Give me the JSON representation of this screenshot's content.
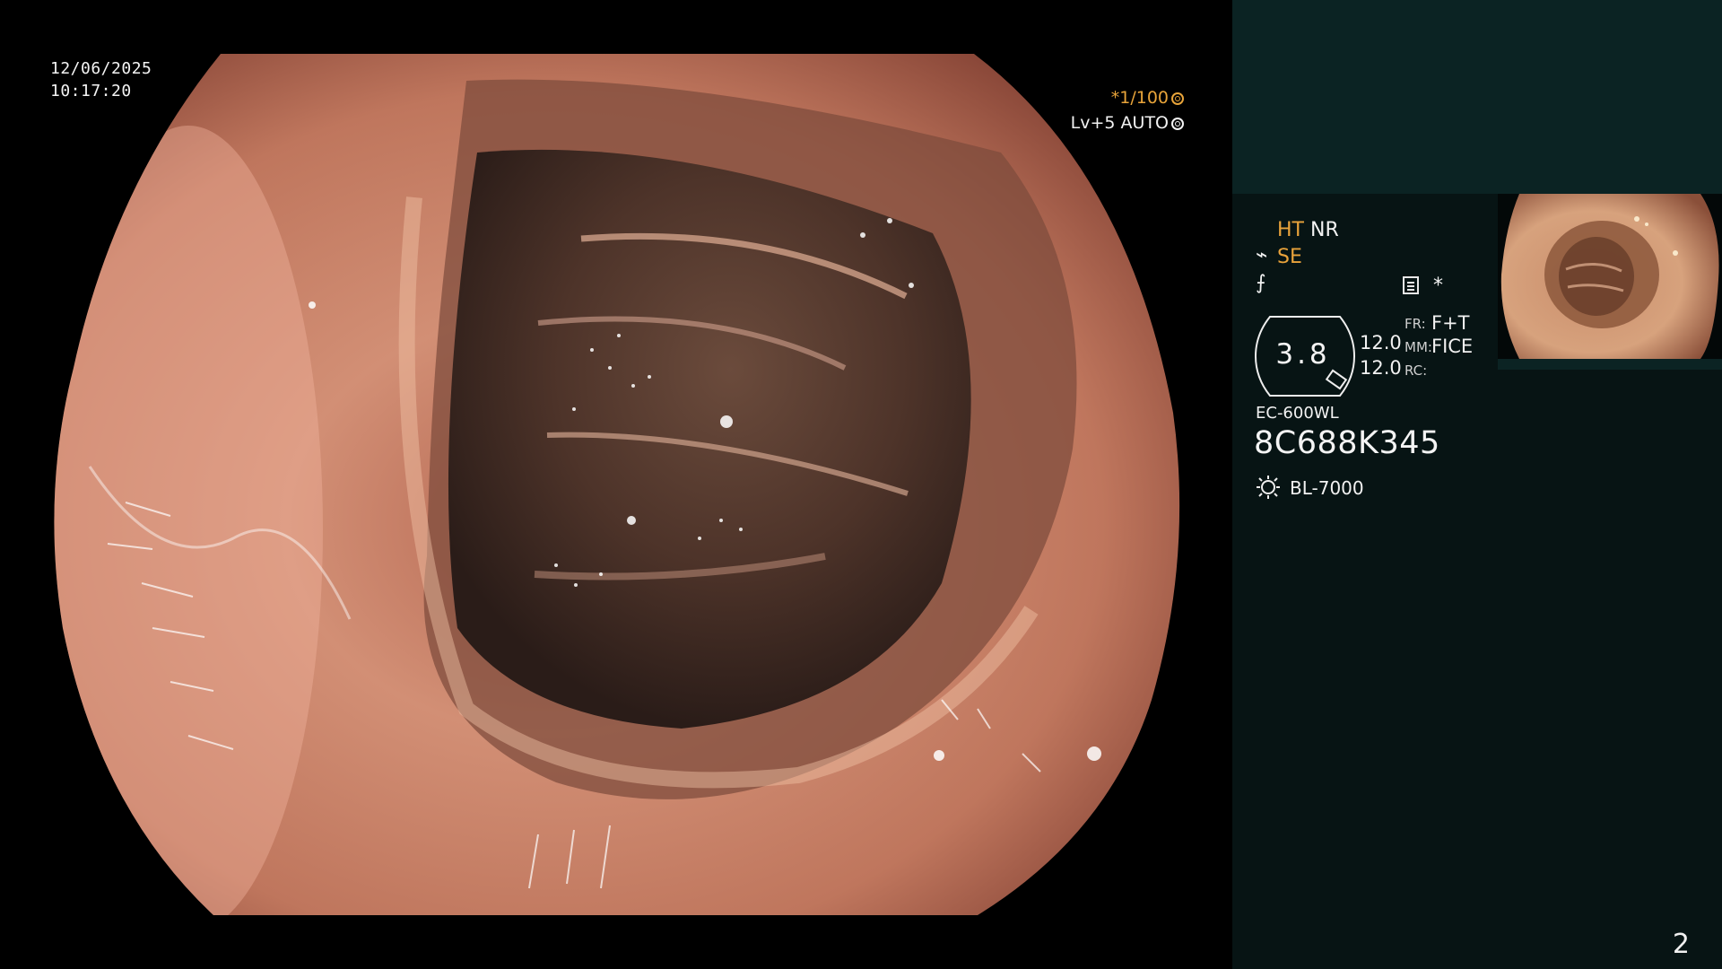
{
  "date": "12/06/2025",
  "time": "10:17:20",
  "shutter": "*1/100",
  "exposure_level": "Lv+5 AUTO",
  "status": {
    "ht": "HT",
    "nr": "NR",
    "se": "SE"
  },
  "zoom": "3.8",
  "settings": [
    {
      "value": "12.0",
      "label": "FR:",
      "mode": "F+T"
    },
    {
      "value": "12.0",
      "label": "MM:",
      "mode": "FICE"
    },
    {
      "label": "RC:"
    }
  ],
  "scope_model": "EC-600WL",
  "serial_number": "8C688K345",
  "light_source": "BL-7000",
  "page_number": "2",
  "colors": {
    "accent": "#e9a33b",
    "panel_background": "#071414",
    "panel_top": "#0b2323"
  },
  "icons": [
    "shutter-icon",
    "auto-icon",
    "brightness-icon",
    "menu-icon",
    "star-icon",
    "zoom-icon",
    "light-source-icon"
  ]
}
